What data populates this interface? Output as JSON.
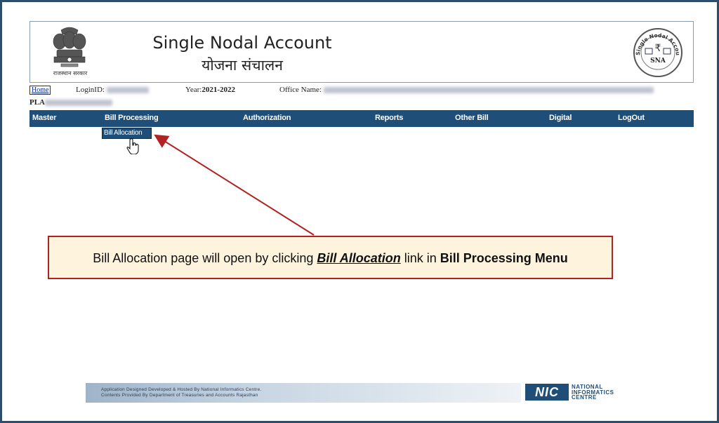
{
  "header": {
    "title_en": "Single Nodal Account",
    "title_hi": "योजना संचालन",
    "emblem_caption": "राजस्थान सरकार",
    "sna_logo_ring": "Single Nodal Account",
    "sna_logo_short": "SNA",
    "rupee_symbol": "₹"
  },
  "info": {
    "home_label": "Home",
    "login_label": "LoginID:",
    "year_label": "Year:",
    "year_value": "2021-2022",
    "office_label": "Office Name:",
    "pla_label": "PLA"
  },
  "menu": {
    "items": [
      "Master",
      "Bill Processing",
      "Authorization",
      "Reports",
      "Other Bill",
      "Digital",
      "LogOut"
    ],
    "submenu_item": "Bill Allocation"
  },
  "callout": {
    "prefix": "Bill Allocation page will open by clicking ",
    "link_text": "Bill Allocation",
    "middle": " link in ",
    "menu_name": "Bill Processing Menu"
  },
  "footer": {
    "line1": "Application Designed Developed & Hosted By National Informatics Centre.",
    "line2": "Contents Provided By Department of Treasuries and Accounts Rajasthan",
    "nic_short": "NIC",
    "nic_line1": "NATIONAL",
    "nic_line2": "INFORMATICS",
    "nic_line3": "CENTRE"
  },
  "colors": {
    "menubar": "#1f4e79",
    "callout_border": "#b22222",
    "callout_bg": "#fef3dc",
    "arrow": "#b22222"
  }
}
